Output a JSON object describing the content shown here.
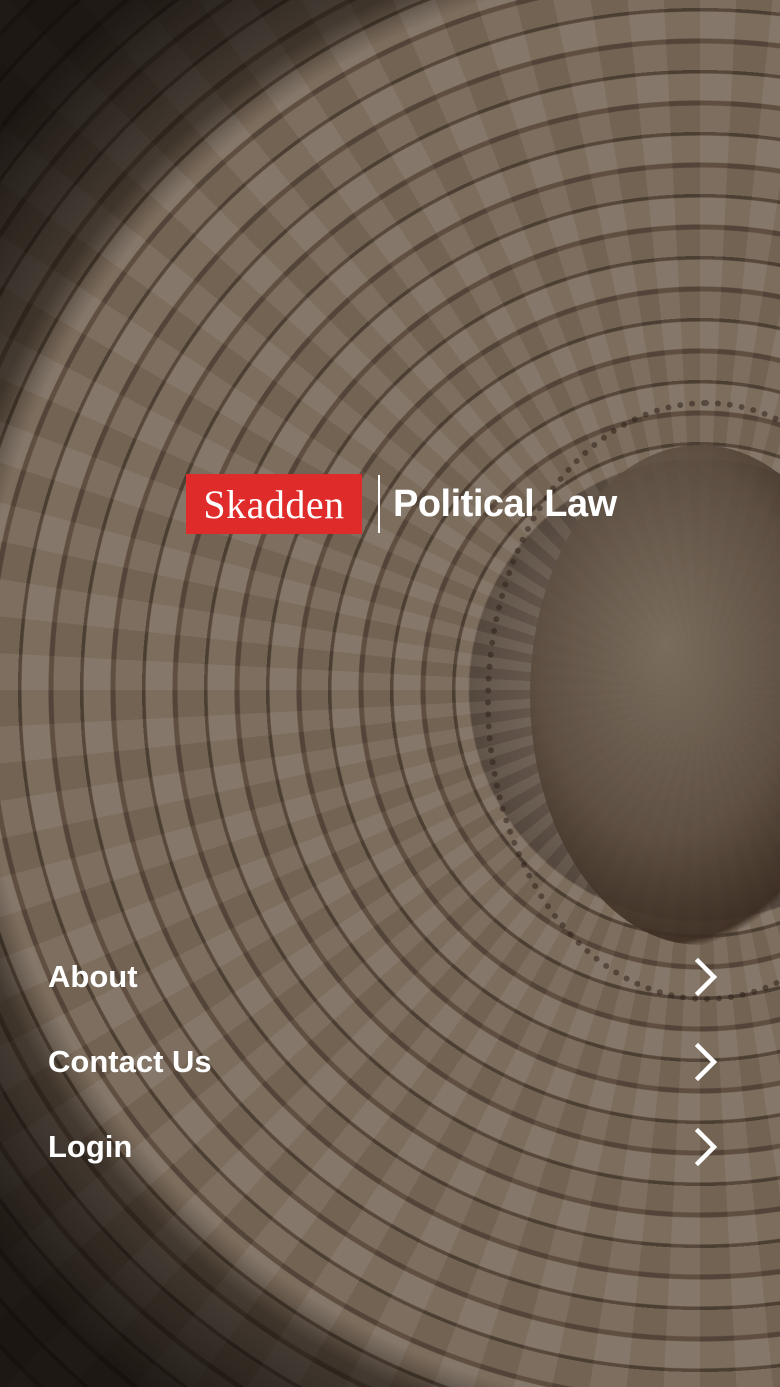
{
  "logo": {
    "brand": "Skadden",
    "product": "Political Law",
    "brand_color": "#e02b2b"
  },
  "menu": {
    "items": [
      {
        "label": "About",
        "icon": "chevron-right-icon"
      },
      {
        "label": "Contact Us",
        "icon": "chevron-right-icon"
      },
      {
        "label": "Login",
        "icon": "chevron-right-icon"
      }
    ]
  }
}
